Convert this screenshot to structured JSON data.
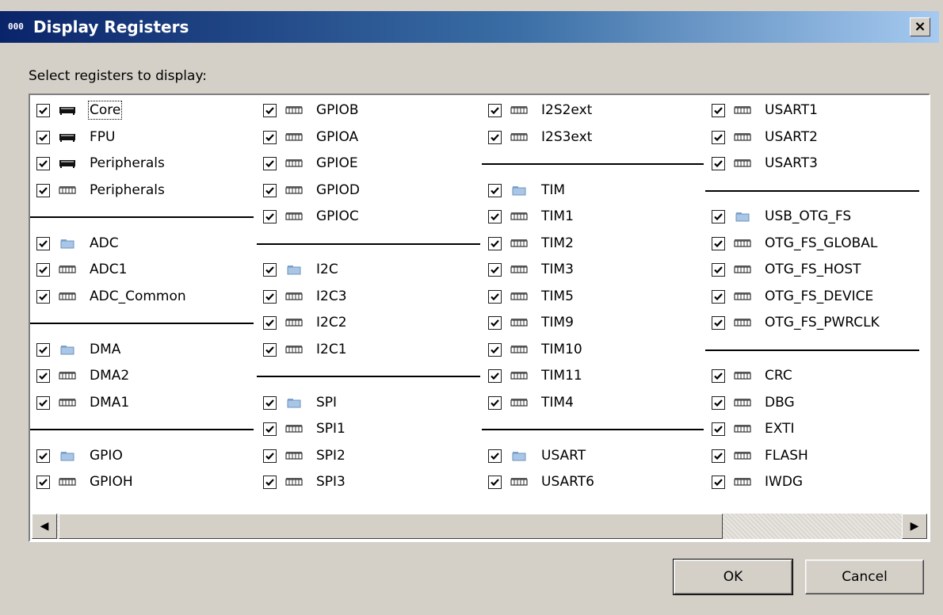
{
  "window": {
    "title": "Display Registers",
    "title_icon": "000",
    "close_label": "×"
  },
  "prompt": "Select registers to display:",
  "columns": [
    [
      {
        "label": "Core",
        "icon": "cpu-icon",
        "checked": true
      },
      {
        "label": "FPU",
        "icon": "cpu-icon",
        "checked": true
      },
      {
        "label": "Peripherals",
        "icon": "cpu-icon",
        "checked": true
      },
      {
        "label": "Peripherals",
        "icon": "register-icon",
        "checked": true
      },
      null,
      {
        "label": "ADC",
        "icon": "folder-icon",
        "checked": true
      },
      {
        "label": "ADC1",
        "icon": "register-icon",
        "checked": true
      },
      {
        "label": "ADC_Common",
        "icon": "register-icon",
        "checked": true
      },
      null,
      {
        "label": "DMA",
        "icon": "folder-icon",
        "checked": true
      },
      {
        "label": "DMA2",
        "icon": "register-icon",
        "checked": true
      },
      {
        "label": "DMA1",
        "icon": "register-icon",
        "checked": true
      },
      null,
      {
        "label": "GPIO",
        "icon": "folder-icon",
        "checked": true
      },
      {
        "label": "GPIOH",
        "icon": "register-icon",
        "checked": true
      }
    ],
    [
      {
        "label": "GPIOB",
        "icon": "register-icon",
        "checked": true
      },
      {
        "label": "GPIOA",
        "icon": "register-icon",
        "checked": true
      },
      {
        "label": "GPIOE",
        "icon": "register-icon",
        "checked": true
      },
      {
        "label": "GPIOD",
        "icon": "register-icon",
        "checked": true
      },
      {
        "label": "GPIOC",
        "icon": "register-icon",
        "checked": true
      },
      null,
      {
        "label": "I2C",
        "icon": "folder-icon",
        "checked": true
      },
      {
        "label": "I2C3",
        "icon": "register-icon",
        "checked": true
      },
      {
        "label": "I2C2",
        "icon": "register-icon",
        "checked": true
      },
      {
        "label": "I2C1",
        "icon": "register-icon",
        "checked": true
      },
      null,
      {
        "label": "SPI",
        "icon": "folder-icon",
        "checked": true
      },
      {
        "label": "SPI1",
        "icon": "register-icon",
        "checked": true
      },
      {
        "label": "SPI2",
        "icon": "register-icon",
        "checked": true
      },
      {
        "label": "SPI3",
        "icon": "register-icon",
        "checked": true
      }
    ],
    [
      {
        "label": "I2S2ext",
        "icon": "register-icon",
        "checked": true
      },
      {
        "label": "I2S3ext",
        "icon": "register-icon",
        "checked": true
      },
      null,
      {
        "label": "TIM",
        "icon": "folder-icon",
        "checked": true
      },
      {
        "label": "TIM1",
        "icon": "register-icon",
        "checked": true
      },
      {
        "label": "TIM2",
        "icon": "register-icon",
        "checked": true
      },
      {
        "label": "TIM3",
        "icon": "register-icon",
        "checked": true
      },
      {
        "label": "TIM5",
        "icon": "register-icon",
        "checked": true
      },
      {
        "label": "TIM9",
        "icon": "register-icon",
        "checked": true
      },
      {
        "label": "TIM10",
        "icon": "register-icon",
        "checked": true
      },
      {
        "label": "TIM11",
        "icon": "register-icon",
        "checked": true
      },
      {
        "label": "TIM4",
        "icon": "register-icon",
        "checked": true
      },
      null,
      {
        "label": "USART",
        "icon": "folder-icon",
        "checked": true
      },
      {
        "label": "USART6",
        "icon": "register-icon",
        "checked": true
      }
    ],
    [
      {
        "label": "USART1",
        "icon": "register-icon",
        "checked": true
      },
      {
        "label": "USART2",
        "icon": "register-icon",
        "checked": true
      },
      {
        "label": "USART3",
        "icon": "register-icon",
        "checked": true
      },
      null,
      {
        "label": "USB_OTG_FS",
        "icon": "folder-icon",
        "checked": true
      },
      {
        "label": "OTG_FS_GLOBAL",
        "icon": "register-icon",
        "checked": true
      },
      {
        "label": "OTG_FS_HOST",
        "icon": "register-icon",
        "checked": true
      },
      {
        "label": "OTG_FS_DEVICE",
        "icon": "register-icon",
        "checked": true
      },
      {
        "label": "OTG_FS_PWRCLK",
        "icon": "register-icon",
        "checked": true
      },
      null,
      {
        "label": "CRC",
        "icon": "register-icon",
        "checked": true
      },
      {
        "label": "DBG",
        "icon": "register-icon",
        "checked": true
      },
      {
        "label": "EXTI",
        "icon": "register-icon",
        "checked": true
      },
      {
        "label": "FLASH",
        "icon": "register-icon",
        "checked": true
      },
      {
        "label": "IWDG",
        "icon": "register-icon",
        "checked": true
      }
    ]
  ],
  "scrollbar": {
    "left_arrow": "◀",
    "right_arrow": "▶"
  },
  "buttons": {
    "ok": "OK",
    "cancel": "Cancel"
  }
}
